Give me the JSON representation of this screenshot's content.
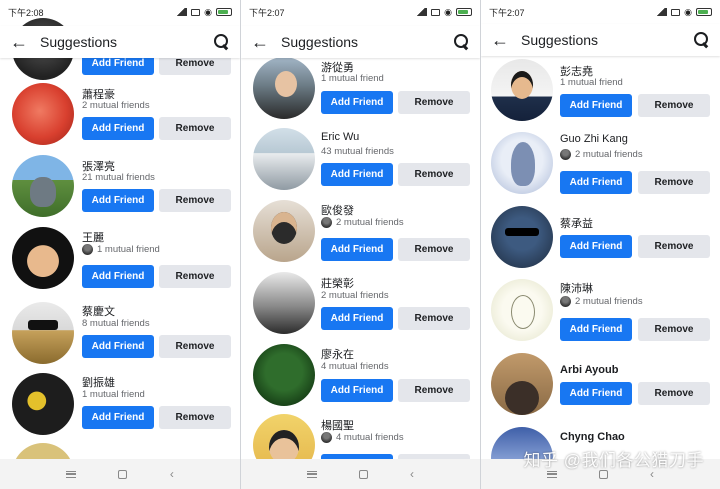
{
  "app_title": "Suggestions",
  "add_label": "Add Friend",
  "remove_label": "Remove",
  "watermark": "知乎 @我们各公猎刀手",
  "screens": [
    {
      "time": "下午2:08",
      "people": [
        {
          "name": "",
          "mutual": "",
          "has_mutual_avatar": false,
          "avatar_icon": "avatar-dark"
        },
        {
          "name": "蕭程豪",
          "mutual": "2 mutual friends",
          "has_mutual_avatar": false,
          "avatar_icon": "avatar-fruit"
        },
        {
          "name": "張澤亮",
          "mutual": "21 mutual friends",
          "has_mutual_avatar": false,
          "avatar_icon": "avatar-totoro"
        },
        {
          "name": "王麗",
          "mutual": "1 mutual friend",
          "has_mutual_avatar": true,
          "avatar_icon": "avatar-memoji"
        },
        {
          "name": "蔡慶文",
          "mutual": "8 mutual friends",
          "has_mutual_avatar": false,
          "avatar_icon": "avatar-sunglasses"
        },
        {
          "name": "劉振雄",
          "mutual": "1 mutual friend",
          "has_mutual_avatar": false,
          "avatar_icon": "avatar-map"
        },
        {
          "name": "",
          "mutual": "",
          "has_mutual_avatar": false,
          "avatar_icon": "avatar-partial"
        }
      ]
    },
    {
      "time": "下午2:07",
      "people": [
        {
          "name": "游從勇",
          "mutual": "1 mutual friend",
          "has_mutual_avatar": false,
          "avatar_icon": "avatar-man-outdoor"
        },
        {
          "name": "Eric Wu",
          "mutual": "43 mutual friends",
          "has_mutual_avatar": false,
          "avatar_icon": "avatar-group"
        },
        {
          "name": "歐俊發",
          "mutual": "2 mutual friends",
          "has_mutual_avatar": true,
          "avatar_icon": "avatar-selfie"
        },
        {
          "name": "莊榮彰",
          "mutual": "2 mutual friends",
          "has_mutual_avatar": false,
          "avatar_icon": "avatar-tree"
        },
        {
          "name": "廖永在",
          "mutual": "4 mutual friends",
          "has_mutual_avatar": false,
          "avatar_icon": "avatar-plant"
        },
        {
          "name": "楊國聖",
          "mutual": "4 mutual friends",
          "has_mutual_avatar": true,
          "avatar_icon": "avatar-boy"
        }
      ]
    },
    {
      "time": "下午2:07",
      "people": [
        {
          "name": "彭志堯",
          "mutual": "1 mutual friend",
          "has_mutual_avatar": false,
          "avatar_icon": "avatar-suit"
        },
        {
          "name": "Guo Zhi Kang",
          "mutual": "2 mutual friends",
          "has_mutual_avatar": true,
          "avatar_icon": "avatar-anime"
        },
        {
          "name": "蔡承益",
          "mutual": "",
          "has_mutual_avatar": false,
          "avatar_icon": "avatar-shades"
        },
        {
          "name": "陳沛琳",
          "mutual": "2 mutual friends",
          "has_mutual_avatar": true,
          "avatar_icon": "avatar-sketch"
        },
        {
          "name": "Arbi Ayoub",
          "mutual": "",
          "has_mutual_avatar": false,
          "avatar_icon": "avatar-arbi"
        },
        {
          "name": "Chyng Chao",
          "mutual": "",
          "has_mutual_avatar": false,
          "avatar_icon": "avatar-castle"
        }
      ]
    }
  ]
}
